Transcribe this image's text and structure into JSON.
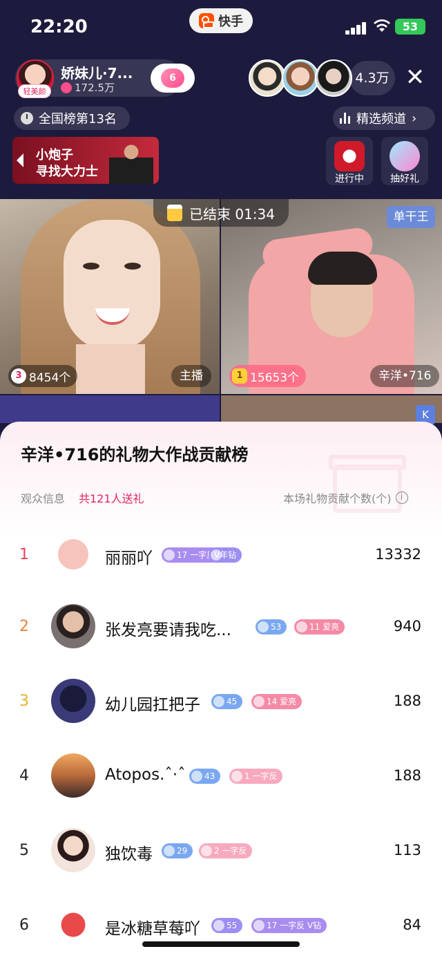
{
  "status_bar": {
    "time": "22:20",
    "app_name": "快手",
    "battery": "53"
  },
  "host": {
    "name": "娇妹儿·7...",
    "tag": "轻美颜",
    "likes": "172.5万",
    "level": "6"
  },
  "viewers": {
    "count": "4.3万"
  },
  "rank": {
    "text": "全国榜第13名"
  },
  "channel": {
    "label": "精选频道"
  },
  "banner": {
    "line1": "小炮子",
    "line2": "寻找大力士"
  },
  "side_buttons": {
    "ongoing": "进行中",
    "lucky_gift": "抽好礼"
  },
  "battle": {
    "status": "已结束 01:34",
    "solo_tag": "单干王",
    "left_count_rank": "3",
    "left_count": "8454个",
    "left_role": "主播",
    "right_count_rank": "1",
    "right_count": "15653个",
    "right_role": "辛洋•716",
    "k_tag": "K"
  },
  "sheet": {
    "title": "辛洋•716的礼物大作战贡献榜",
    "audience_label": "观众信息",
    "gifters": "共121人送礼",
    "count_header": "本场礼物贡献个数(个)"
  },
  "ranking": [
    {
      "rank": "1",
      "name": "丽丽吖",
      "badges": [
        {
          "text": "17 一字反",
          "style": "purple"
        },
        {
          "text": "V年钻",
          "style": "violet"
        }
      ],
      "count": "13332"
    },
    {
      "rank": "2",
      "name": "张发亮要请我吃...",
      "badges": [
        {
          "text": "53",
          "style": "blue"
        },
        {
          "text": "11 爱亮",
          "style": "pink"
        }
      ],
      "count": "940"
    },
    {
      "rank": "3",
      "name": "幼儿园扛把子",
      "badges": [
        {
          "text": "45",
          "style": "blue"
        },
        {
          "text": "14 爱亮",
          "style": "pink"
        }
      ],
      "count": "188"
    },
    {
      "rank": "4",
      "name": "Atopos.ˆ·ˆ",
      "badges": [
        {
          "text": "43",
          "style": "blue"
        },
        {
          "text": "1 一字反",
          "style": "pinkl"
        }
      ],
      "count": "188"
    },
    {
      "rank": "5",
      "name": "独饮毒",
      "badges": [
        {
          "text": "29",
          "style": "blue"
        },
        {
          "text": "2 一字反",
          "style": "pinkl"
        }
      ],
      "count": "113"
    },
    {
      "rank": "6",
      "name": "是冰糖草莓吖",
      "badges": [
        {
          "text": "55",
          "style": "violet"
        },
        {
          "text": "17 一字反 V钻",
          "style": "purple"
        }
      ],
      "count": "84"
    }
  ],
  "colors": {
    "accent": "#e0245e",
    "header_bg": "#1c1b3d"
  }
}
